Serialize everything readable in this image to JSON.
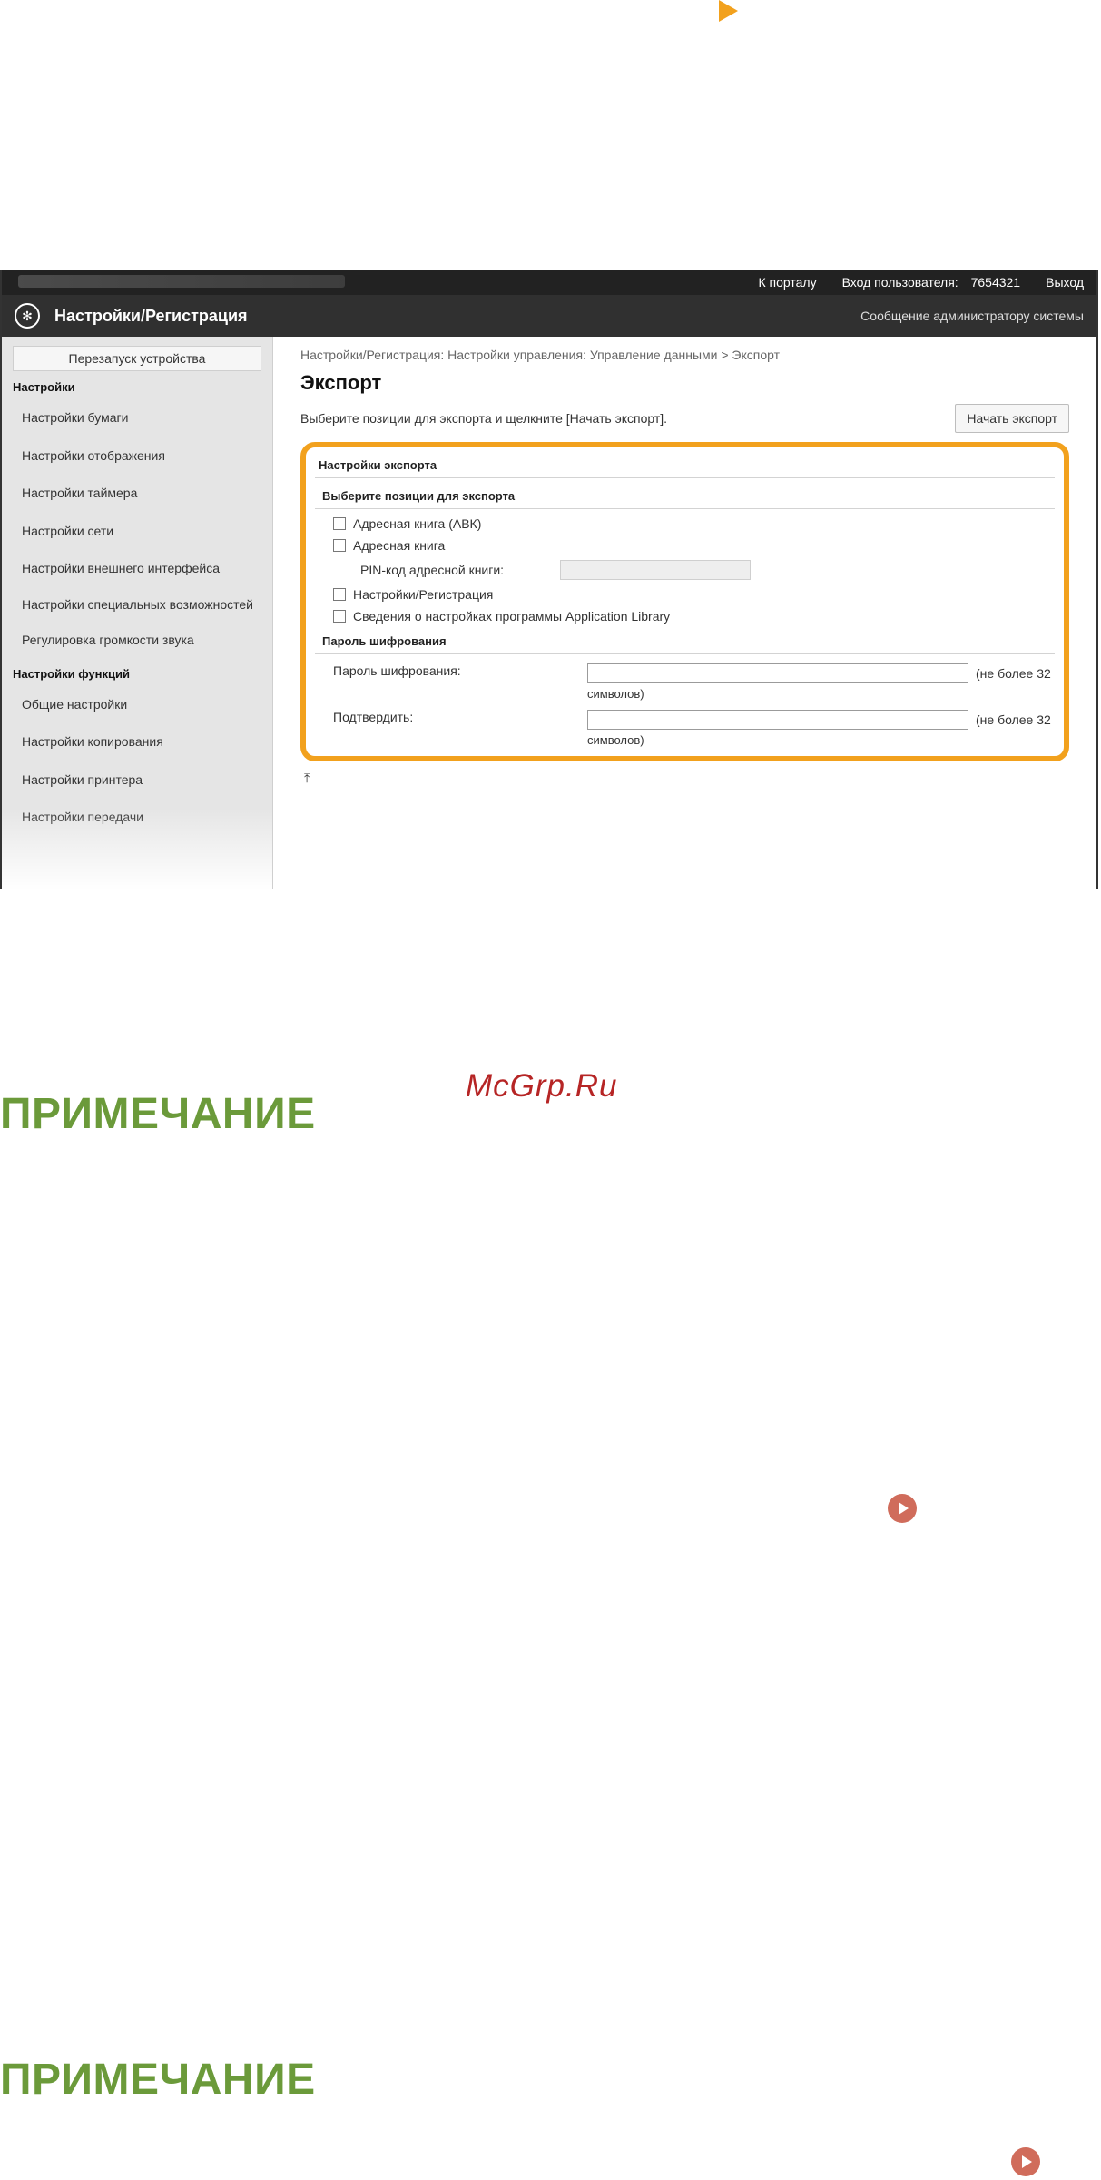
{
  "doc": {
    "sections": [
      {
        "heading": "ПРИМЕЧАНИЕ"
      },
      {
        "heading": "ПРИМЕЧАНИЕ"
      }
    ],
    "watermark": "McGrp.Ru"
  },
  "ui": {
    "topbar": {
      "portal_link": "К порталу",
      "user_label": "Вход пользователя:",
      "user_id": "7654321",
      "logout": "Выход"
    },
    "header": {
      "title": "Настройки/Регистрация",
      "admin_message_link": "Сообщение администратору системы"
    },
    "sidebar": {
      "restart_button": "Перезапуск устройства",
      "settings_title": "Настройки",
      "settings_items": [
        "Настройки бумаги",
        "Настройки отображения",
        "Настройки таймера",
        "Настройки сети",
        "Настройки внешнего интерфейса",
        "Настройки специальных возможностей",
        "Регулировка громкости звука"
      ],
      "functions_title": "Настройки функций",
      "function_items": [
        "Общие настройки",
        "Настройки копирования",
        "Настройки принтера",
        "Настройки передачи"
      ]
    },
    "content": {
      "breadcrumb": "Настройки/Регистрация: Настройки управления: Управление данными > Экспорт",
      "title": "Экспорт",
      "description": "Выберите позиции для экспорта и щелкните [Начать экспорт].",
      "start_export_button": "Начать экспорт",
      "box": {
        "title": "Настройки экспорта",
        "select_items_title": "Выберите позиции для экспорта",
        "items": [
          "Адресная книга (АВК)",
          "Адресная книга",
          "Настройки/Регистрация",
          "Сведения о настройках программы Application Library"
        ],
        "pin_label": "PIN-код адресной книги:",
        "encryption_title": "Пароль шифрования",
        "password_label": "Пароль шифрования:",
        "confirm_label": "Подтвердить:",
        "max_note_1": "(не более 32",
        "max_note_2": "символов)"
      },
      "to_top_icon": "to-top-icon"
    }
  }
}
